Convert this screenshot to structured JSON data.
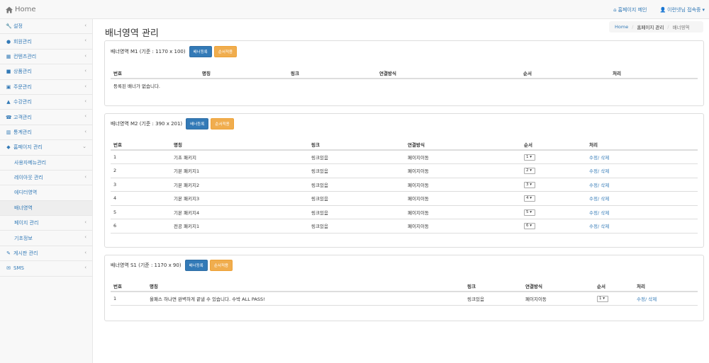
{
  "topnav": {
    "brand": "Home",
    "home_link": "홈페이지 메인",
    "user": "이런넷님 접속중"
  },
  "sidebar": {
    "items": [
      {
        "label": "설정",
        "icon": "wrench-icon"
      },
      {
        "label": "회원관리",
        "icon": "user-icon"
      },
      {
        "label": "컨텐츠관리",
        "icon": "columns-icon"
      },
      {
        "label": "상품관리",
        "icon": "gift-icon"
      },
      {
        "label": "주문관리",
        "icon": "cart-icon"
      },
      {
        "label": "수강관리",
        "icon": "graduation-cap-icon"
      },
      {
        "label": "고객관리",
        "icon": "phone-icon"
      },
      {
        "label": "통계관리",
        "icon": "bar-chart-icon"
      },
      {
        "label": "홈페이지 관리",
        "icon": "car-icon"
      },
      {
        "label": "사용자메뉴관리"
      },
      {
        "label": "레이아웃 관리"
      },
      {
        "label": "에디터영역"
      },
      {
        "label": "배너영역"
      },
      {
        "label": "페이지 관리"
      },
      {
        "label": "기초정보"
      },
      {
        "label": "게시판 관리",
        "icon": "edit-icon"
      },
      {
        "label": "SMS",
        "icon": "envelope-icon"
      }
    ]
  },
  "page": {
    "title": "배너영역 관리",
    "breadcrumb": [
      "Home",
      "홈페이지 관리",
      "배너영역"
    ]
  },
  "panels": [
    {
      "title": "배너영역 M1 (기준 : 1170 x 100)",
      "btn_register": "배너등록",
      "btn_order": "순서적용",
      "headers": [
        "번호",
        "명칭",
        "링크",
        "연결방식",
        "순서",
        "처리"
      ],
      "empty_message": "등록된 배너가 없습니다.",
      "rows": []
    },
    {
      "title": "배너영역 M2 (기준 : 390 x 201)",
      "btn_register": "배너등록",
      "btn_order": "순서적용",
      "headers": [
        "번호",
        "명칭",
        "링크",
        "연결방식",
        "순서",
        "처리"
      ],
      "rows": [
        {
          "no": "1",
          "name": "기초 패키지",
          "link": "링크있음",
          "method": "페이지이동",
          "order": "1",
          "action": "수정/ 삭제"
        },
        {
          "no": "2",
          "name": "기본 패키지1",
          "link": "링크있음",
          "method": "페이지이동",
          "order": "2",
          "action": "수정/ 삭제"
        },
        {
          "no": "3",
          "name": "기본 패키지2",
          "link": "링크있음",
          "method": "페이지이동",
          "order": "3",
          "action": "수정/ 삭제"
        },
        {
          "no": "4",
          "name": "기본 패키지3",
          "link": "링크있음",
          "method": "페이지이동",
          "order": "4",
          "action": "수정/ 삭제"
        },
        {
          "no": "5",
          "name": "기본 패키지4",
          "link": "링크있음",
          "method": "페이지이동",
          "order": "5",
          "action": "수정/ 삭제"
        },
        {
          "no": "6",
          "name": "전공 패키지1",
          "link": "링크있음",
          "method": "페이지이동",
          "order": "6",
          "action": "수정/ 삭제"
        }
      ]
    },
    {
      "title": "배너영역 S1 (기준 : 1170 x 90)",
      "btn_register": "배너등록",
      "btn_order": "순서적용",
      "headers": [
        "번호",
        "명칭",
        "링크",
        "연결방식",
        "순서",
        "처리"
      ],
      "rows": [
        {
          "no": "1",
          "name": "올패스 하나면 완벽하게 끝낼 수 있습니다. 수박 ALL PASS!",
          "link": "링크있음",
          "method": "페이지이동",
          "order": "1",
          "action": "수정/ 삭제"
        }
      ]
    }
  ],
  "colors": {
    "link": "#337ab7",
    "primary": "#337ab7",
    "warning": "#f0ad4e"
  }
}
